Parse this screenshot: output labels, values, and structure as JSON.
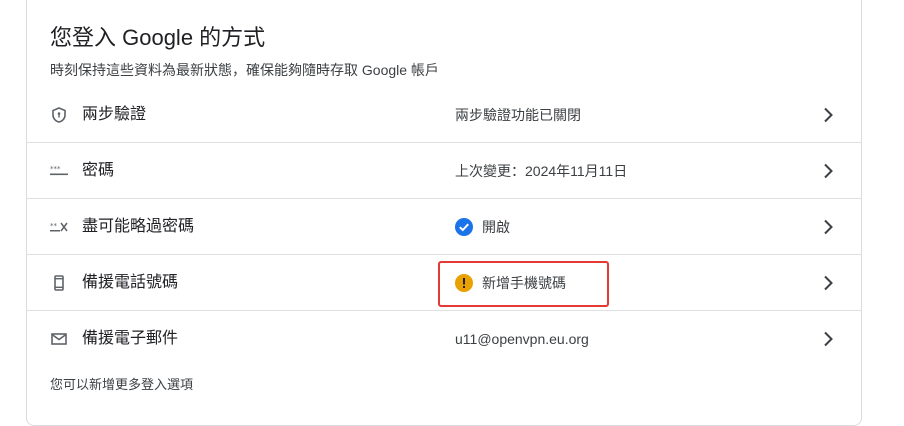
{
  "header": {
    "title": "您登入 Google 的方式",
    "subtitle": "時刻保持這些資料為最新狀態，確保能夠隨時存取 Google 帳戶"
  },
  "rows": [
    {
      "icon": "shield-icon",
      "label": "兩步驗證",
      "value": "兩步驗證功能已關閉",
      "status_icon": null
    },
    {
      "icon": "password-dots-icon",
      "label": "密碼",
      "value": "上次變更：2024年11月11日",
      "status_icon": null
    },
    {
      "icon": "skip-password-icon",
      "label": "盡可能略過密碼",
      "value": "開啟",
      "status_icon": "check-circle-icon"
    },
    {
      "icon": "phone-icon",
      "label": "備援電話號碼",
      "value": "新增手機號碼",
      "status_icon": "warning-circle-icon"
    },
    {
      "icon": "mail-icon",
      "label": "備援電子郵件",
      "value": "u11@openvpn.eu.org",
      "status_icon": null
    }
  ],
  "footer": {
    "text": "您可以新增更多登入選項"
  },
  "colors": {
    "check": "#1a73e8",
    "warning": "#e8a100",
    "highlight": "#e53935",
    "icon": "#5f6368"
  }
}
